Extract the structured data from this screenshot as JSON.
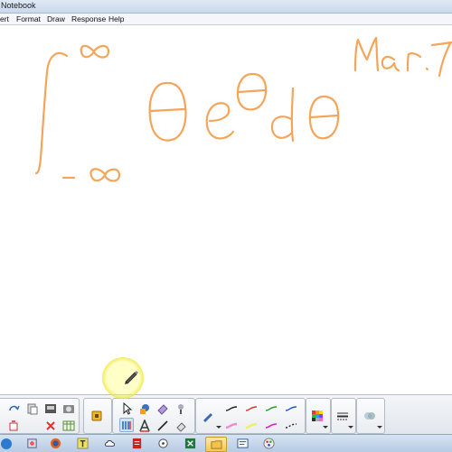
{
  "window": {
    "title": "Notebook"
  },
  "menu": {
    "items": [
      {
        "id": "insert",
        "label": "ert"
      },
      {
        "id": "format",
        "label": "Format"
      },
      {
        "id": "draw",
        "label": "Draw"
      },
      {
        "id": "response",
        "label": "Response"
      },
      {
        "id": "help",
        "label": "Help"
      }
    ]
  },
  "colors": {
    "ink": "#f5a55a",
    "titlebar": "#c9d8ec",
    "toolbar": "#e2e6ec",
    "taskbar": "#b7cbe4",
    "highlight": "#f2e44a"
  },
  "canvas": {
    "ink_content": "handwritten integral of theta e^theta d-theta from minus infinity to infinity, dated Mar. 7"
  },
  "toolbar": {
    "buttons": [
      "redo-icon",
      "paste-icon",
      "screen-shade-icon",
      "capture-icon",
      "delete-icon",
      "table-icon",
      "cursor-select-icon",
      "shapes-icon",
      "eraser-icon",
      "magic-pen-icon",
      "lock-icon",
      "pen-tool-icon",
      "text-tool-icon",
      "line-tool-icon",
      "fill-icon",
      "pen-icon",
      "line-style-icon",
      "color-palette-icon",
      "properties-icon",
      "link-icon"
    ]
  },
  "taskbar": {
    "apps": [
      "start-icon",
      "internet-explorer-icon",
      "firefox-icon",
      "notebook-icon",
      "cloud-icon",
      "pdf-icon",
      "gadget-icon",
      "excel-icon",
      "folder-icon",
      "notebook-window-icon",
      "paint-icon"
    ]
  }
}
